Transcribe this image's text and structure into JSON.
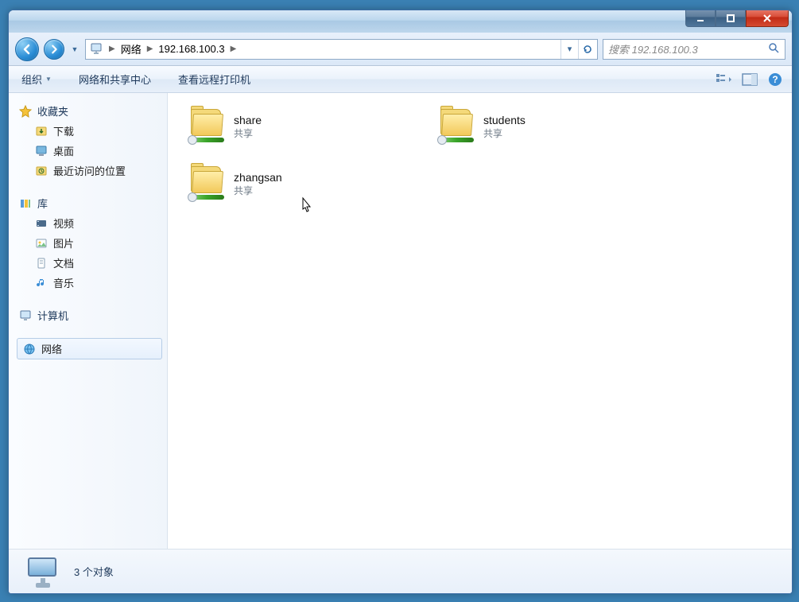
{
  "address": {
    "root": "网络",
    "host": "192.168.100.3"
  },
  "search": {
    "placeholder": "搜索 192.168.100.3"
  },
  "toolbar": {
    "organize": "组织",
    "network_center": "网络和共享中心",
    "view_remote_printers": "查看远程打印机"
  },
  "sidebar": {
    "favorites": {
      "label": "收藏夹",
      "items": [
        "下载",
        "桌面",
        "最近访问的位置"
      ]
    },
    "libraries": {
      "label": "库",
      "items": [
        "视频",
        "图片",
        "文档",
        "音乐"
      ]
    },
    "computer": {
      "label": "计算机"
    },
    "network": {
      "label": "网络"
    }
  },
  "items": [
    {
      "name": "share",
      "sub": "共享"
    },
    {
      "name": "students",
      "sub": "共享"
    },
    {
      "name": "zhangsan",
      "sub": "共享"
    }
  ],
  "status": {
    "count_label": "3 个对象"
  }
}
